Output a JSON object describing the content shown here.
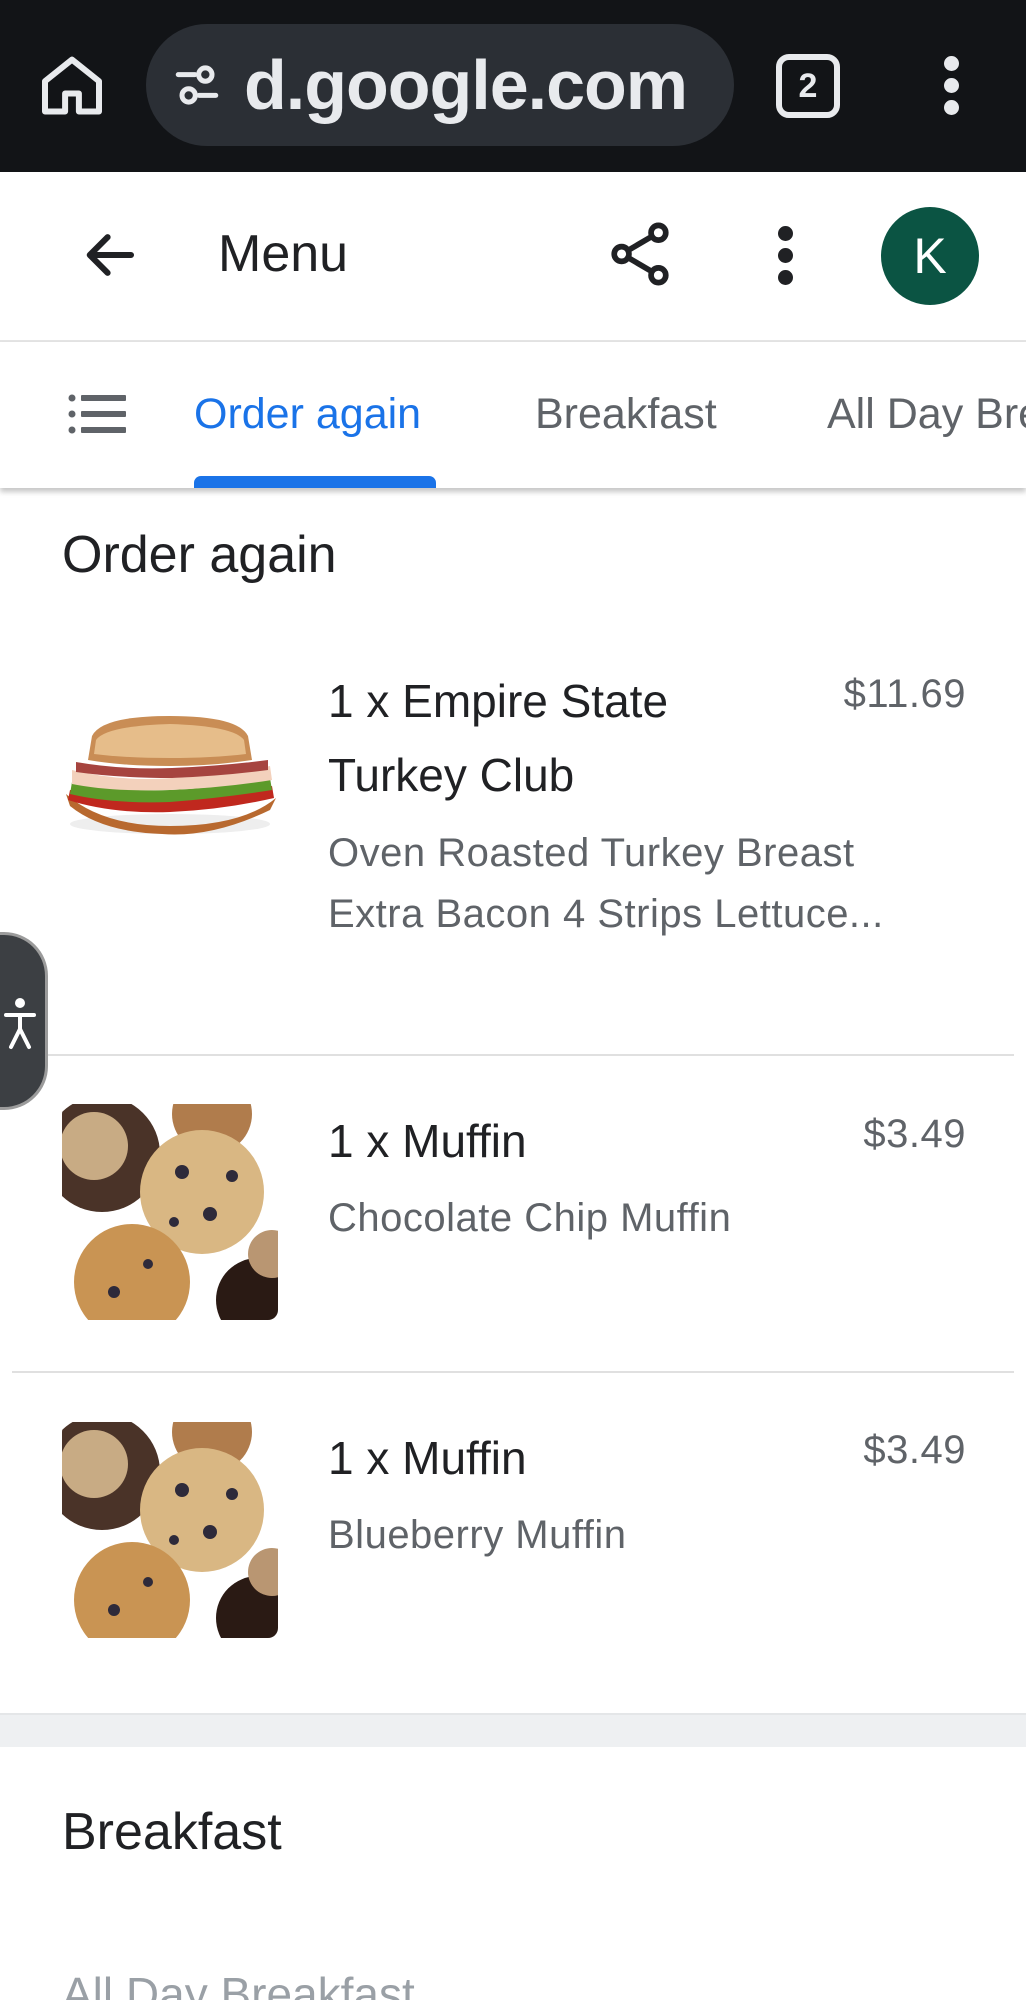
{
  "browser": {
    "url": "d.google.com",
    "tab_count": "2"
  },
  "header": {
    "title": "Menu",
    "avatar_initial": "K",
    "avatar_color": "#0b5443"
  },
  "tabs": [
    {
      "label": "Order again",
      "active": true
    },
    {
      "label": "Breakfast",
      "active": false
    },
    {
      "label": "All Day Breakfast",
      "active": false
    }
  ],
  "accent_color": "#1a73e8",
  "order_again": {
    "title": "Order again",
    "items": [
      {
        "name": "1 x Empire State Turkey Club",
        "description": "Oven Roasted Turkey Breast Extra Bacon 4 Strips Lettuce...",
        "price": "$11.69",
        "image": "turkey-club-sandwich"
      },
      {
        "name": "1 x Muffin",
        "description": "Chocolate Chip Muffin",
        "price": "$3.49",
        "image": "muffins"
      },
      {
        "name": "1 x Muffin",
        "description": "Blueberry Muffin",
        "price": "$3.49",
        "image": "muffins"
      }
    ]
  },
  "breakfast_section": {
    "title": "Breakfast"
  },
  "next_section_peek": "All Day Breakfast"
}
